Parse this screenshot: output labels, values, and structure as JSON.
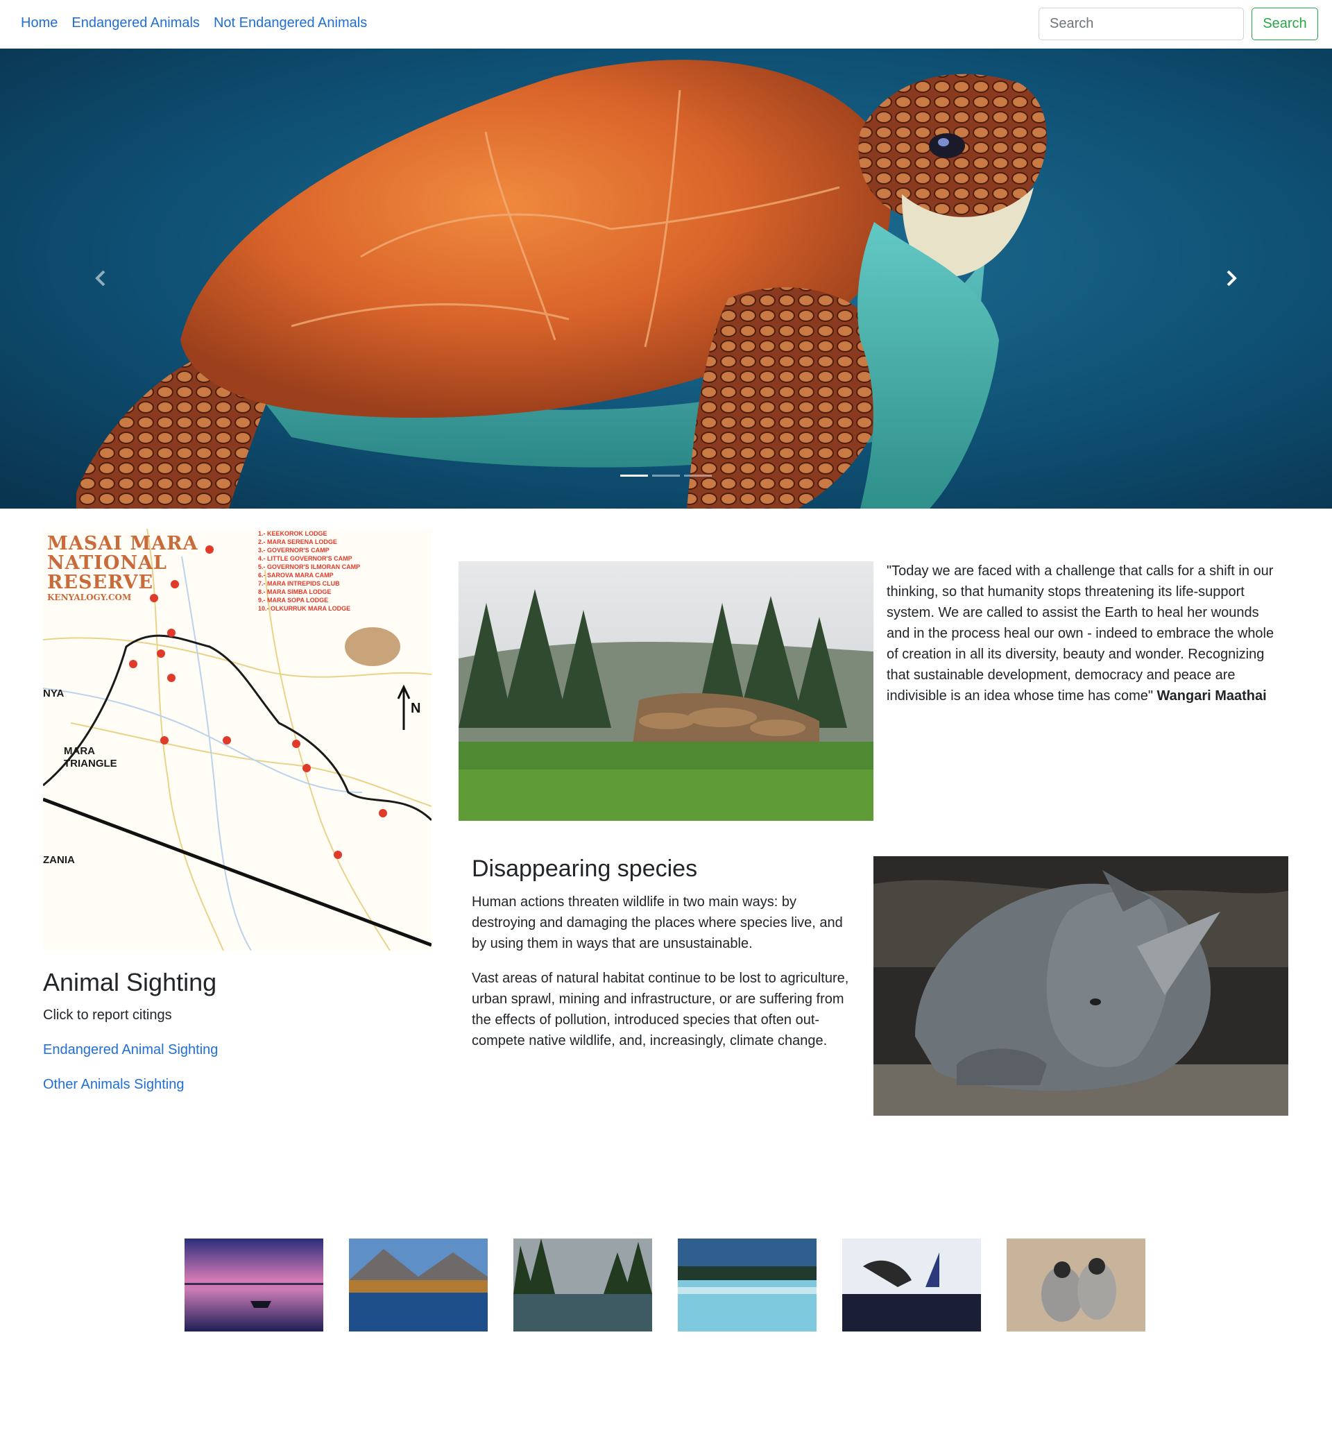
{
  "nav": {
    "links": [
      "Home",
      "Endangered Animals",
      "Not Endangered Animals"
    ],
    "search_placeholder": "Search",
    "search_button": "Search"
  },
  "carousel": {
    "slide_count": 3,
    "active_index": 0,
    "image": "sea-turtle"
  },
  "map": {
    "title_lines": [
      "MASAI MARA",
      "NATIONAL",
      "RESERVE"
    ],
    "subtitle": "KENYALOGY.COM"
  },
  "sighting": {
    "title": "Animal Sighting",
    "text": "Click to report citings",
    "links": [
      "Endangered Animal Sighting",
      "Other Animals Sighting"
    ]
  },
  "quote": {
    "text": "\"Today we are faced with a challenge that calls for a shift in our thinking, so that humanity stops threatening its life-support system. We are called to assist the Earth to heal her wounds and in the process heal our own - indeed to embrace the whole of creation in all its diversity, beauty and wonder. Recognizing that sustainable development, democracy and peace are indivisible is an idea whose time has come\"",
    "author": "Wangari Maathai"
  },
  "species": {
    "title": "Disappearing species",
    "paragraphs": [
      "Human actions threaten wildlife in two main ways: by destroying and damaging the places where species live, and by using them in ways that are unsustainable.",
      "Vast areas of natural habitat continue to be lost to agriculture, urban sprawl, mining and infrastructure, or are suffering from the effects of pollution, introduced species that often out-compete native wildlife, and, increasingly, climate change."
    ]
  },
  "thumbnails": [
    "sunset-boat",
    "mountain-lake",
    "forest-lake",
    "misty-lake",
    "winter-bird",
    "monkeys"
  ],
  "colors": {
    "link": "#1f6fd6",
    "success": "#28a745",
    "text": "#212529",
    "sea": "#0e4f73"
  }
}
